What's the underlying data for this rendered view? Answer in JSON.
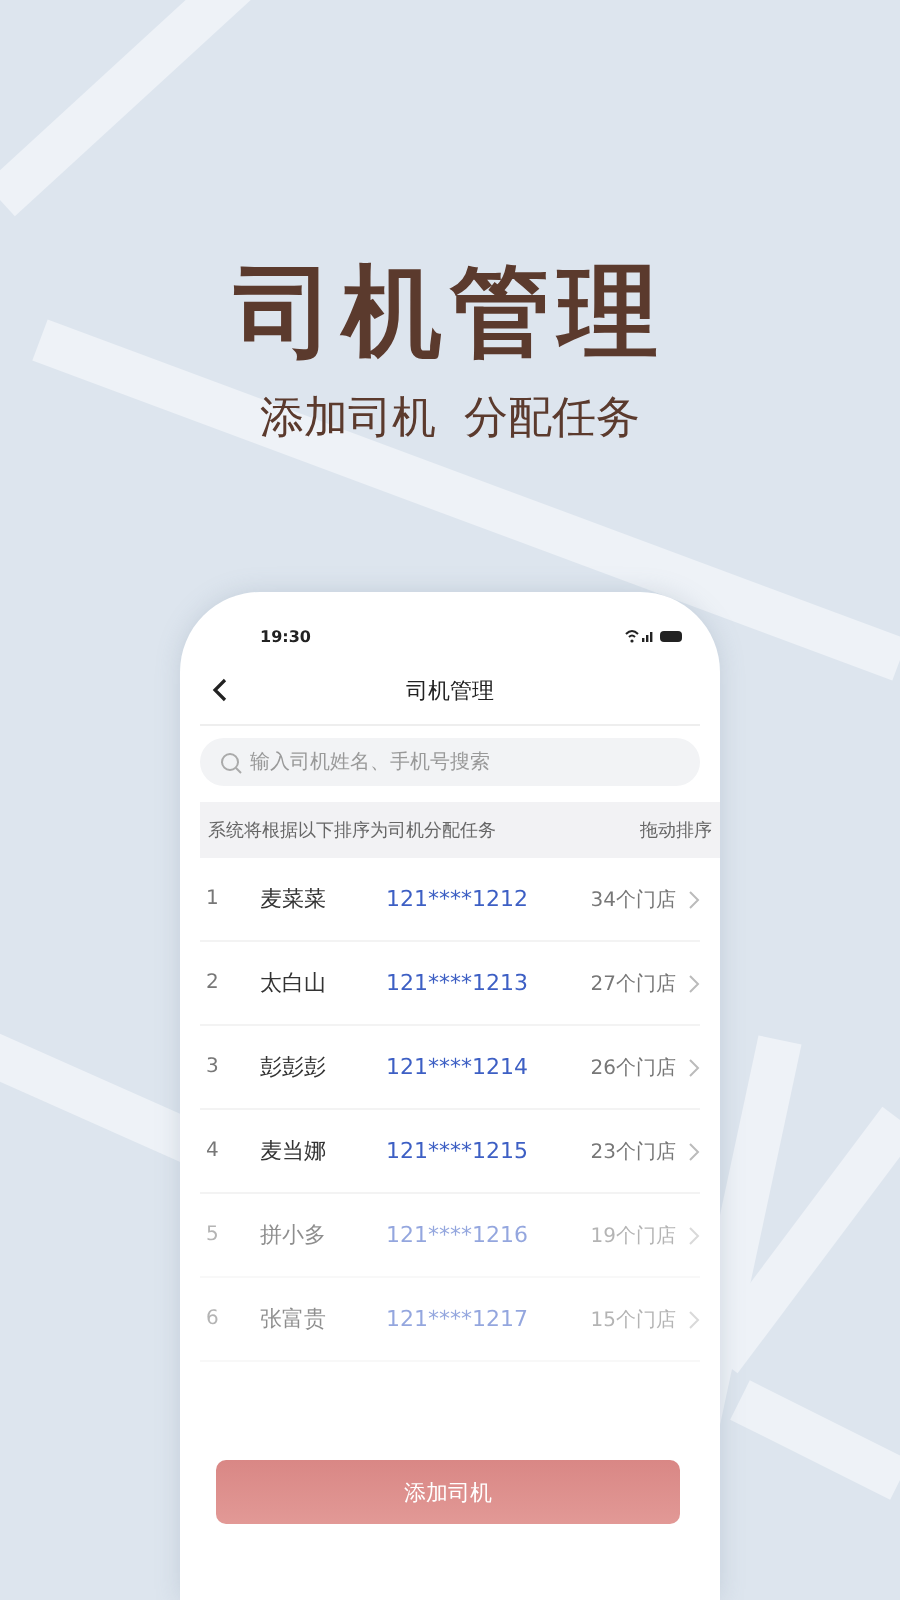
{
  "headline": "司机管理",
  "subtitle": "添加司机  分配任务",
  "phone": {
    "status_time": "19:30",
    "nav_title": "司机管理",
    "search": {
      "placeholder": "输入司机姓名、手机号搜索"
    },
    "notice": {
      "text": "系统将根据以下排序为司机分配任务",
      "action": "拖动排序"
    },
    "drivers": [
      {
        "index": "1",
        "name": "麦菜菜",
        "phone": "121****1212",
        "stores": "34个门店",
        "faded": false
      },
      {
        "index": "2",
        "name": "太白山",
        "phone": "121****1213",
        "stores": "27个门店",
        "faded": false
      },
      {
        "index": "3",
        "name": "彭彭彭",
        "phone": "121****1214",
        "stores": "26个门店",
        "faded": false
      },
      {
        "index": "4",
        "name": "麦当娜",
        "phone": "121****1215",
        "stores": "23个门店",
        "faded": false
      },
      {
        "index": "5",
        "name": "拼小多",
        "phone": "121****1216",
        "stores": "19个门店",
        "faded": true
      },
      {
        "index": "6",
        "name": "张富贵",
        "phone": "121****1217",
        "stores": "15个门店",
        "faded": true
      }
    ],
    "add_button": {
      "label": "添加司机",
      "disabled": true
    }
  }
}
